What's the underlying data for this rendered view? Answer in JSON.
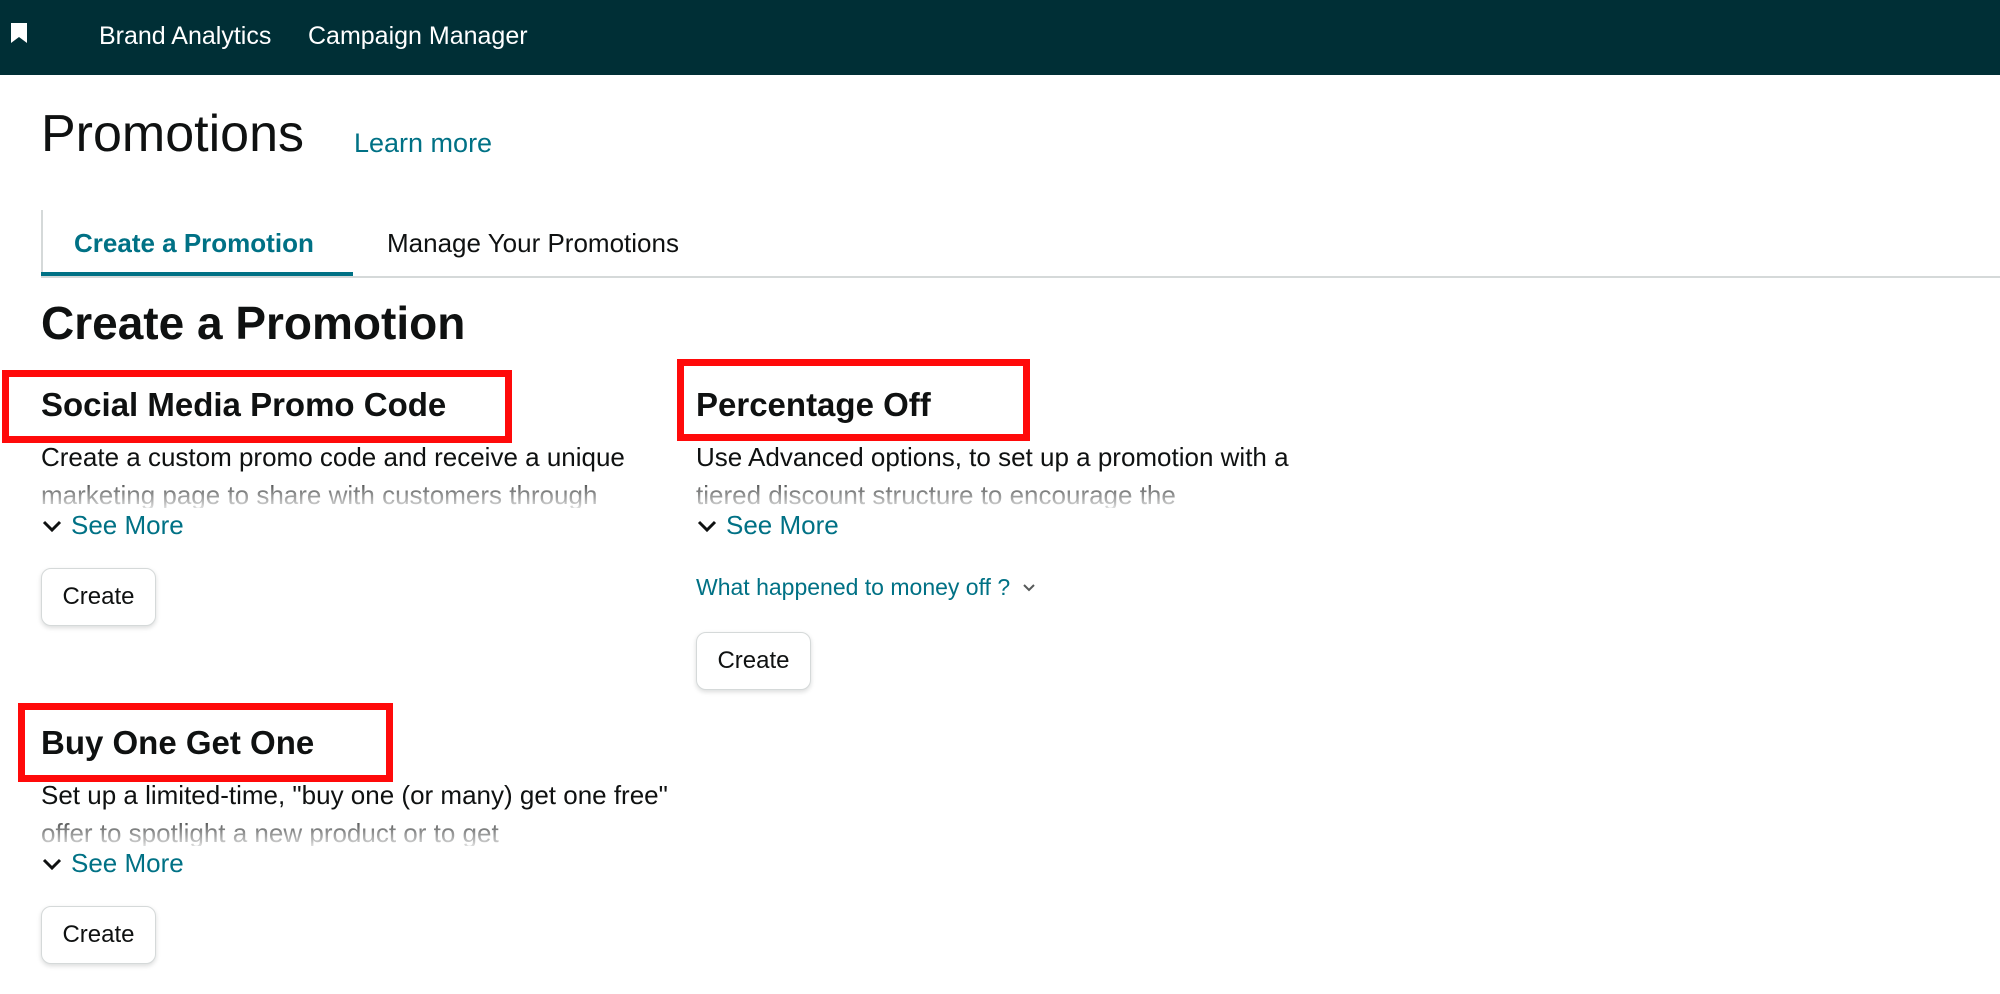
{
  "topbar": {
    "nav_items": [
      "Brand Analytics",
      "Campaign Manager"
    ],
    "icon": "bookmark-icon"
  },
  "page": {
    "title": "Promotions",
    "learn_more": "Learn more"
  },
  "tabs": [
    {
      "label": "Create a Promotion",
      "active": true
    },
    {
      "label": "Manage Your Promotions",
      "active": false
    }
  ],
  "section_title": "Create a Promotion",
  "cards": [
    {
      "title": "Social Media Promo Code",
      "description": "Create a custom promo code and receive a unique marketing page to share with customers through",
      "see_more": "See More",
      "create_label": "Create"
    },
    {
      "title": "Percentage Off",
      "description": "Use Advanced options, to set up a promotion with a tiered discount structure to encourage the",
      "see_more": "See More",
      "extra_link": "What happened to money off ?",
      "create_label": "Create"
    },
    {
      "title": "Buy One Get One",
      "description": "Set up a limited-time, \"buy one (or many) get one free\" offer to spotlight a new product or to get",
      "see_more": "See More",
      "create_label": "Create"
    }
  ],
  "colors": {
    "topbar_bg": "#002f36",
    "link": "#007185",
    "highlight": "#ff0a0a"
  }
}
